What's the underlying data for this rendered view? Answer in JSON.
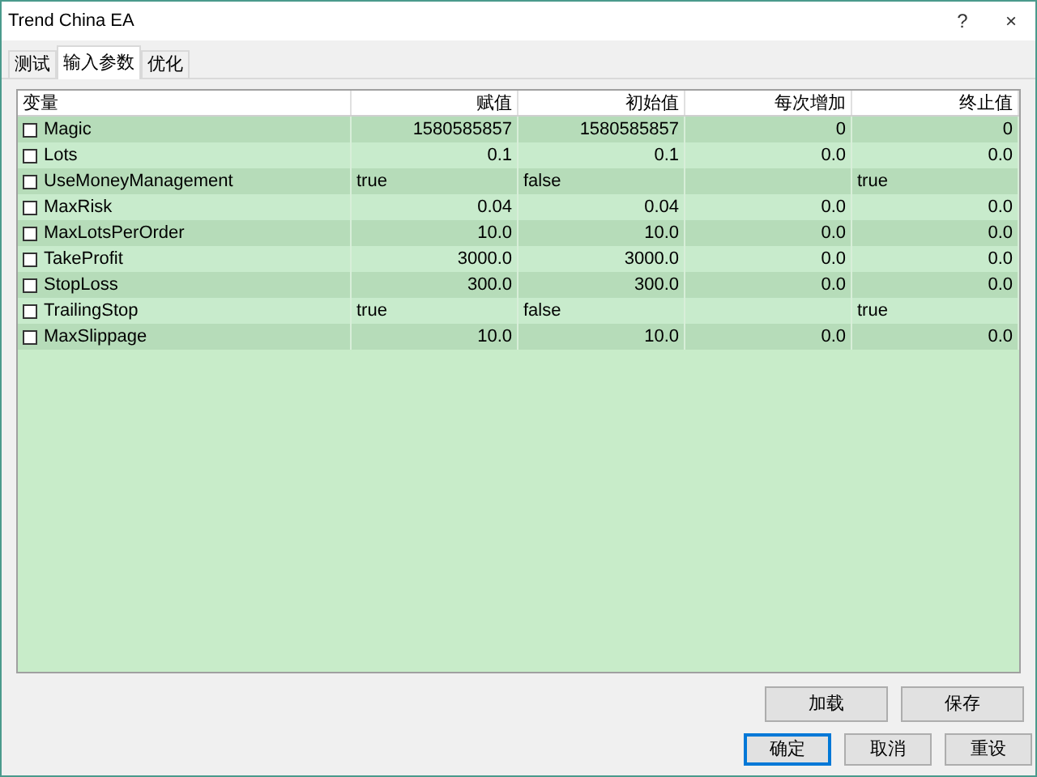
{
  "window": {
    "title": "Trend China EA",
    "controls": [
      "?",
      "×"
    ]
  },
  "tabs": [
    {
      "label": "测试",
      "selected": false
    },
    {
      "label": "输入参数",
      "selected": true
    },
    {
      "label": "优化",
      "selected": false
    }
  ],
  "table": {
    "columns": [
      "变量",
      "赋值",
      "初始值",
      "每次增加",
      "终止值"
    ],
    "rows": [
      {
        "name": "Magic",
        "checked": false,
        "kind": "number",
        "value": "1580585857",
        "start": "1580585857",
        "step": "0",
        "stop": "0"
      },
      {
        "name": "Lots",
        "checked": false,
        "kind": "number",
        "value": "0.1",
        "start": "0.1",
        "step": "0.0",
        "stop": "0.0"
      },
      {
        "name": "UseMoneyManagement",
        "checked": false,
        "kind": "bool",
        "value": "true",
        "start": "false",
        "stop": "true"
      },
      {
        "name": "MaxRisk",
        "checked": false,
        "kind": "number",
        "value": "0.04",
        "start": "0.04",
        "step": "0.0",
        "stop": "0.0"
      },
      {
        "name": "MaxLotsPerOrder",
        "checked": false,
        "kind": "number",
        "value": "10.0",
        "start": "10.0",
        "step": "0.0",
        "stop": "0.0"
      },
      {
        "name": "TakeProfit",
        "checked": false,
        "kind": "number",
        "value": "3000.0",
        "start": "3000.0",
        "step": "0.0",
        "stop": "0.0"
      },
      {
        "name": "StopLoss",
        "checked": false,
        "kind": "number",
        "value": "300.0",
        "start": "300.0",
        "step": "0.0",
        "stop": "0.0"
      },
      {
        "name": "TrailingStop",
        "checked": false,
        "kind": "bool",
        "value": "true",
        "start": "false",
        "stop": "true"
      },
      {
        "name": "MaxSlippage",
        "checked": false,
        "kind": "number",
        "value": "10.0",
        "start": "10.0",
        "step": "0.0",
        "stop": "0.0"
      }
    ]
  },
  "side_buttons": [
    "加载",
    "保存"
  ],
  "buttons": [
    {
      "label": "确定",
      "selected": true
    },
    {
      "label": "取消",
      "selected": false
    },
    {
      "label": "重设",
      "selected": false
    }
  ]
}
